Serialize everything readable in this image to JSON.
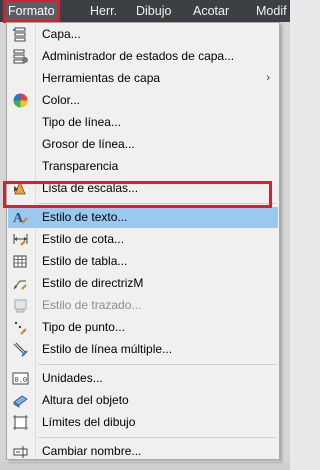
{
  "menubar": {
    "items": [
      {
        "label": "Formato",
        "active": true
      },
      {
        "label": "Herr."
      },
      {
        "label": "Dibujo"
      },
      {
        "label": "Acotar"
      },
      {
        "label": "Modif"
      }
    ]
  },
  "menu": {
    "items": [
      {
        "label": "Capa...",
        "icon": "layer-icon"
      },
      {
        "label": "Administrador de estados de capa...",
        "icon": "layer-states-icon"
      },
      {
        "label": "Herramientas de capa",
        "icon": "",
        "submenu": true
      },
      {
        "label": "Color...",
        "icon": "color-wheel-icon"
      },
      {
        "label": "Tipo de línea...",
        "icon": ""
      },
      {
        "label": "Grosor de línea...",
        "icon": ""
      },
      {
        "label": "Transparencia",
        "icon": ""
      },
      {
        "label": "Lista de escalas...",
        "icon": "scale-list-icon"
      },
      {
        "label": "Estilo de texto...",
        "icon": "text-style-icon",
        "highlighted": true
      },
      {
        "label": "Estilo de cota...",
        "icon": "dimension-style-icon"
      },
      {
        "label": "Estilo de tabla...",
        "icon": "table-style-icon"
      },
      {
        "label": "Estilo de directrizM",
        "icon": "multileader-style-icon"
      },
      {
        "label": "Estilo de trazado...",
        "icon": "plot-style-icon",
        "disabled": true
      },
      {
        "label": "Tipo de punto...",
        "icon": "point-style-icon"
      },
      {
        "label": "Estilo de línea múltiple...",
        "icon": "multiline-style-icon"
      },
      {
        "label": "Unidades...",
        "icon": "units-icon"
      },
      {
        "label": "Altura del objeto",
        "icon": "thickness-icon"
      },
      {
        "label": "Límites del dibujo",
        "icon": "drawing-limits-icon"
      },
      {
        "label": "Cambiar nombre...",
        "icon": "rename-icon"
      }
    ],
    "submenu_arrow": "›"
  },
  "colors": {
    "menubar_bg": "#3c3f43",
    "highlight_bg": "#99c9ef",
    "annotation_red": "#e21b2c"
  }
}
